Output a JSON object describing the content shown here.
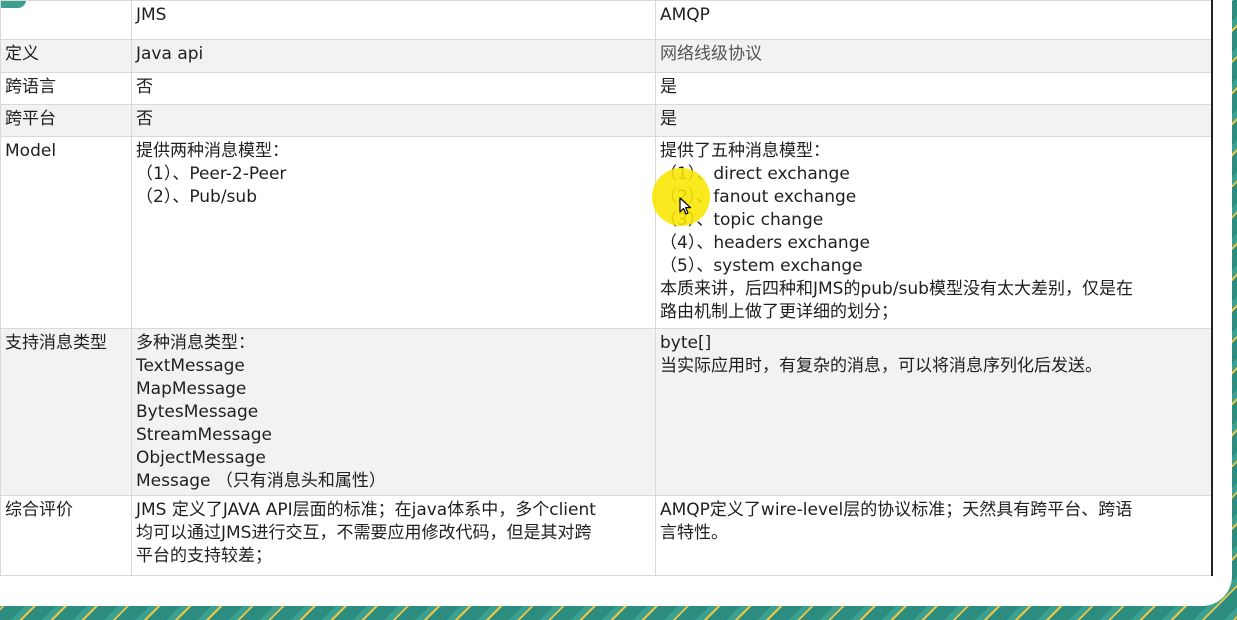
{
  "table": {
    "header": {
      "col0": "",
      "col1": "JMS",
      "col2": "AMQP"
    },
    "rows": [
      {
        "label": "定义",
        "jms": [
          "Java api"
        ],
        "amqp": [
          "网络线级协议"
        ]
      },
      {
        "label": "跨语言",
        "jms": [
          "否"
        ],
        "amqp": [
          "是"
        ]
      },
      {
        "label": "跨平台",
        "jms": [
          "否"
        ],
        "amqp": [
          "是"
        ]
      },
      {
        "label": "Model",
        "jms": [
          "提供两种消息模型：",
          "（1）、Peer-2-Peer",
          "（2）、Pub/sub"
        ],
        "amqp": [
          "提供了五种消息模型：",
          "（1）、direct exchange",
          "（2）、fanout exchange",
          "（3）、topic change",
          "（4）、headers exchange",
          "（5）、system exchange",
          "本质来讲，后四种和JMS的pub/sub模型没有太大差别，仅是在",
          "路由机制上做了更详细的划分；"
        ]
      },
      {
        "label": "支持消息类型",
        "jms": [
          "多种消息类型：",
          "TextMessage",
          "MapMessage",
          "BytesMessage",
          "StreamMessage",
          "ObjectMessage",
          "Message （只有消息头和属性）"
        ],
        "amqp": [
          "byte[]",
          "当实际应用时，有复杂的消息，可以将消息序列化后发送。"
        ]
      },
      {
        "label": "综合评价",
        "jms": [
          "JMS 定义了JAVA API层面的标准；在java体系中，多个client",
          "均可以通过JMS进行交互，不需要应用修改代码，但是其对跨",
          "平台的支持较差；"
        ],
        "amqp": [
          "AMQP定义了wire-level层的协议标准；天然具有跨平台、跨语",
          "言特性。"
        ]
      }
    ]
  },
  "icons": {
    "cursor": "pointer-cursor-icon",
    "highlight": "cursor-highlight"
  },
  "colors": {
    "highlight": "#fae600",
    "border": "#d9d9d9",
    "alt_row": "#f2f2f2",
    "frame": "#2e8f82"
  }
}
